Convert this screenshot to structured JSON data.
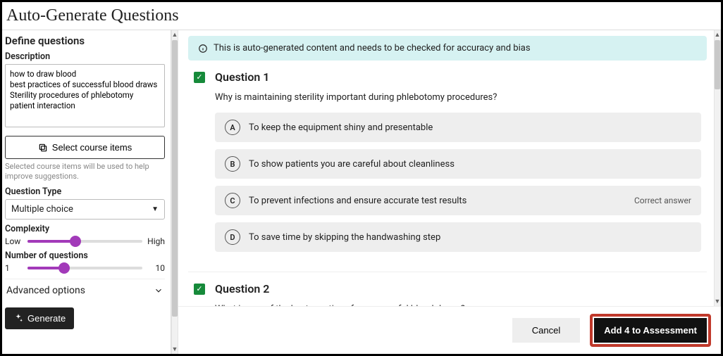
{
  "page_title": "Auto-Generate Questions",
  "left": {
    "heading": "Define questions",
    "description_label": "Description",
    "description_value": "how to draw blood\nbest practices of successful blood draws\nSterility procedures of phlebotomy\npatient interaction",
    "select_items_label": "Select course items",
    "select_items_hint": "Selected course items will be used to help improve suggestions.",
    "question_type_label": "Question Type",
    "question_type_value": "Multiple choice",
    "complexity_label": "Complexity",
    "complexity_low": "Low",
    "complexity_high": "High",
    "complexity_percent": 42,
    "num_label": "Number of questions",
    "num_min": "1",
    "num_max": "10",
    "num_percent": 32,
    "advanced_label": "Advanced options",
    "generate_label": "Generate"
  },
  "banner": "This is auto-generated content and needs to be checked for accuracy and bias",
  "questions": [
    {
      "title": "Question 1",
      "prompt": "Why is maintaining sterility important during phlebotomy procedures?",
      "options": [
        {
          "letter": "A",
          "text": "To keep the equipment shiny and presentable",
          "correct": false
        },
        {
          "letter": "B",
          "text": "To show patients you are careful about cleanliness",
          "correct": false
        },
        {
          "letter": "C",
          "text": "To prevent infections and ensure accurate test results",
          "correct": true
        },
        {
          "letter": "D",
          "text": "To save time by skipping the handwashing step",
          "correct": false
        }
      ]
    },
    {
      "title": "Question 2",
      "prompt": "What is one of the best practices for successful blood draws?",
      "options": []
    }
  ],
  "correct_label": "Correct answer",
  "footer": {
    "cancel": "Cancel",
    "add": "Add 4 to Assessment"
  }
}
